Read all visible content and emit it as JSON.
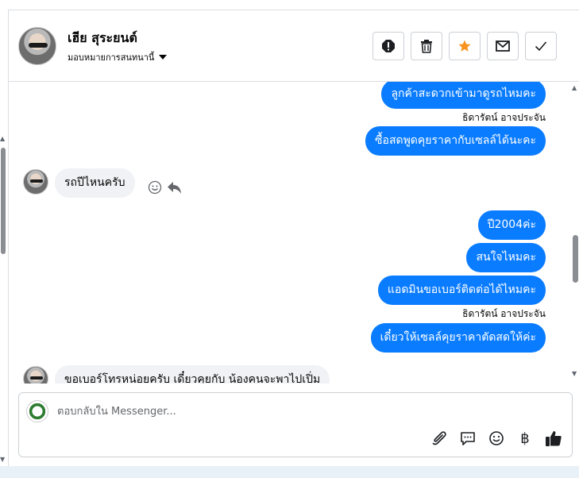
{
  "header": {
    "name": "เฮีย สุระยนต์",
    "assign_label": "มอบหมายการสนทนานี้",
    "actions": [
      {
        "name": "spam-icon"
      },
      {
        "name": "trash-icon"
      },
      {
        "name": "star-icon"
      },
      {
        "name": "mail-icon"
      },
      {
        "name": "check-icon"
      }
    ]
  },
  "messages": {
    "out_1": "ลูกค้าสะดวกเข้ามาดูรถไหมคะ",
    "sender_1": "ธิดารัตน์ อาจประจัน",
    "out_2": "ซื้อสดพูดคุยราคากับเซลล์ได้นะคะ",
    "in_1": "รถปีไหนครับ",
    "out_3": "ปี2004ค่ะ",
    "out_4": "สนใจไหมคะ",
    "out_5": "แอดมินขอเบอร์ติดต่อได้ไหมคะ",
    "sender_2": "ธิดารัตน์ อาจประจัน",
    "out_6": "เดี๋ยวให้เซลล์คุยราคาตัดสดให้ค่ะ",
    "in_2": "ขอเบอร์โทรหน่อยครับ เดี๋ยวคุยกับ น้องคนจะพาไปเปิ่ม"
  },
  "composer": {
    "placeholder": "ตอบกลับใน Messenger...",
    "tools": [
      "paperclip-icon",
      "saved-reply-icon",
      "emoji-icon",
      "baht-icon",
      "thumbs-up-icon"
    ]
  },
  "colors": {
    "accent": "#0a7cff",
    "incoming_bg": "#f0f2f5",
    "star": "#f7931e"
  }
}
